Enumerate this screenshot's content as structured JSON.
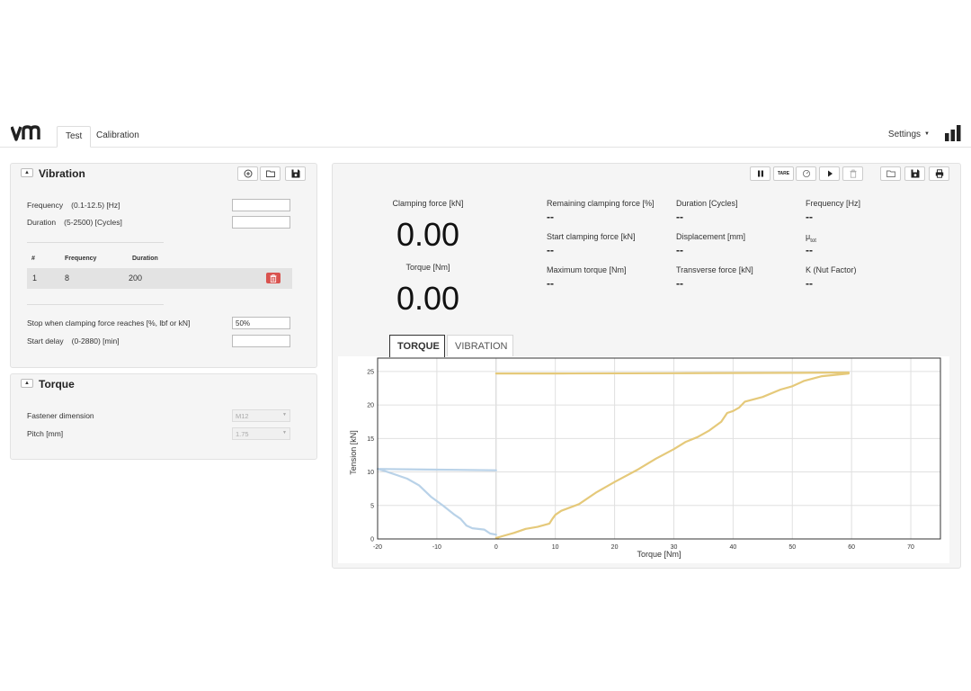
{
  "nav": {
    "tabs": [
      "Test",
      "Calibration"
    ],
    "active_tab": "Test",
    "settings_label": "Settings",
    "settings_caret": "▼"
  },
  "vibration": {
    "title": "Vibration",
    "collapse_glyph": "▲",
    "frequency_label": "Frequency",
    "frequency_hint": "(0.1-12.5) [Hz]",
    "frequency_value": "",
    "duration_label": "Duration",
    "duration_hint": "(5-2500) [Cycles]",
    "duration_value": "",
    "table": {
      "headers": [
        "#",
        "Frequency",
        "Duration"
      ],
      "rows": [
        [
          "1",
          "8",
          "200"
        ]
      ]
    },
    "stop_label": "Stop when clamping force reaches [%, lbf or kN]",
    "stop_value": "50%",
    "delay_label": "Start delay",
    "delay_hint": "(0-2880) [min]",
    "delay_value": ""
  },
  "torque": {
    "title": "Torque",
    "collapse_glyph": "▲",
    "fastener_label": "Fastener dimension",
    "fastener_value": "M12",
    "pitch_label": "Pitch [mm]",
    "pitch_value": "1.75",
    "select_arrow": "▼"
  },
  "toolbar": {
    "tare_label": "TARE"
  },
  "readings": {
    "clamping_label": "Clamping force [kN]",
    "clamping_value": "0.00",
    "torque_label": "Torque [Nm]",
    "torque_value": "0.00",
    "metrics": [
      {
        "label": "Remaining clamping force [%]",
        "value": "--"
      },
      {
        "label": "Duration [Cycles]",
        "value": "--"
      },
      {
        "label": "Frequency [Hz]",
        "value": "--"
      },
      {
        "label": "Start clamping force [kN]",
        "value": "--"
      },
      {
        "label": "Displacement [mm]",
        "value": "--"
      },
      {
        "label": "μ",
        "sub": "tot",
        "value": "--"
      },
      {
        "label": "Maximum torque [Nm]",
        "value": "--"
      },
      {
        "label": "Transverse force [kN]",
        "value": "--"
      },
      {
        "label": "K (Nut Factor)",
        "value": "--"
      }
    ]
  },
  "chart_tabs": [
    "TORQUE",
    "VIBRATION"
  ],
  "active_chart_tab": "TORQUE",
  "colors": {
    "accent_danger": "#d9534f",
    "series_yellow": "#e5c97a",
    "series_blue": "#b9d2e8"
  },
  "chart_data": {
    "type": "line",
    "xlabel": "Torque [Nm]",
    "ylabel": "Tension [kN]",
    "xlim": [
      -20,
      75
    ],
    "ylim": [
      0,
      27
    ],
    "x_ticks": [
      -20,
      -10,
      0,
      10,
      20,
      30,
      40,
      50,
      60,
      70
    ],
    "y_ticks": [
      0,
      5,
      10,
      15,
      20,
      25
    ],
    "grid": true,
    "series": [
      {
        "color": "#e5c97a",
        "points": [
          [
            0,
            24.7
          ],
          [
            10,
            24.7
          ],
          [
            30,
            24.75
          ],
          [
            50,
            24.8
          ],
          [
            59.5,
            24.85
          ],
          [
            59.5,
            24.7
          ],
          [
            55,
            24.3
          ],
          [
            52,
            23.6
          ],
          [
            50,
            22.8
          ],
          [
            48,
            22.3
          ],
          [
            45,
            21.2
          ],
          [
            42,
            20.5
          ],
          [
            41,
            19.6
          ],
          [
            40,
            19.1
          ],
          [
            39,
            18.8
          ],
          [
            38,
            17.5
          ],
          [
            36,
            16.2
          ],
          [
            34,
            15.2
          ],
          [
            32,
            14.5
          ],
          [
            30,
            13.4
          ],
          [
            27,
            12.0
          ],
          [
            24,
            10.4
          ],
          [
            20,
            8.5
          ],
          [
            17,
            7.0
          ],
          [
            14,
            5.2
          ],
          [
            11,
            4.2
          ],
          [
            10,
            3.6
          ],
          [
            9.5,
            3.0
          ],
          [
            9,
            2.3
          ],
          [
            7,
            1.8
          ],
          [
            5,
            1.5
          ],
          [
            3,
            0.9
          ],
          [
            1,
            0.4
          ],
          [
            0,
            0.15
          ],
          [
            0.3,
            0.05
          ]
        ]
      },
      {
        "color": "#b9d2e8",
        "points": [
          [
            0,
            10.25
          ],
          [
            -5,
            10.3
          ],
          [
            -10,
            10.35
          ],
          [
            -15,
            10.4
          ],
          [
            -20,
            10.45
          ],
          [
            -19,
            10.2
          ],
          [
            -17,
            9.6
          ],
          [
            -15,
            9.0
          ],
          [
            -13,
            8.0
          ],
          [
            -11,
            6.3
          ],
          [
            -9,
            5.0
          ],
          [
            -7,
            3.6
          ],
          [
            -6,
            3.0
          ],
          [
            -5,
            2.0
          ],
          [
            -4,
            1.6
          ],
          [
            -2,
            1.4
          ],
          [
            -1,
            0.8
          ],
          [
            0,
            0.65
          ]
        ]
      }
    ]
  }
}
